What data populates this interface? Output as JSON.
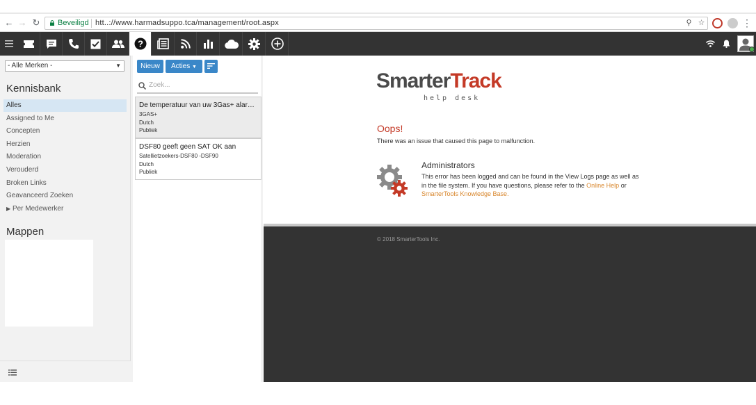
{
  "browser": {
    "secure_label": "Beveiligd",
    "url": "htt..://www.harmadsuppo.tca/management/root.aspx"
  },
  "toolbar": {
    "icons": [
      "ticket-icon",
      "chat-icon",
      "phone-icon",
      "task-check-icon",
      "users-icon",
      "help-icon",
      "news-icon",
      "rss-icon",
      "reports-chart-icon",
      "cloud-icon",
      "settings-gear-icon",
      "add-circle-icon"
    ],
    "active_index": 5
  },
  "left": {
    "brand_select": "- Alle Merken -",
    "kb_title": "Kennisbank",
    "items": [
      {
        "label": "Alles",
        "selected": true
      },
      {
        "label": "Assigned to Me"
      },
      {
        "label": "Concepten"
      },
      {
        "label": "Herzien"
      },
      {
        "label": "Moderation"
      },
      {
        "label": "Verouderd"
      },
      {
        "label": "Broken Links"
      },
      {
        "label": "Geavanceerd Zoeken"
      },
      {
        "label": "Per Medewerker"
      }
    ],
    "folders_title": "Mappen"
  },
  "list": {
    "new_label": "Nieuw",
    "actions_label": "Acties",
    "search_placeholder": "Zoek...",
    "articles": [
      {
        "title": "De temperatuur van uw 3Gas+ alarm of ...",
        "tag": "3GAS+",
        "language": "Dutch",
        "visibility": "Publiek"
      },
      {
        "title": "DSF80 geeft geen SAT OK aan",
        "tag": "Satellietzoekers-DSF80 -DSF90",
        "language": "Dutch",
        "visibility": "Publiek"
      }
    ]
  },
  "content": {
    "logo_main_a": "Smarter",
    "logo_main_b": "Track",
    "logo_sub": "help desk",
    "oops": "Oops!",
    "oops_sub": "There was an issue that caused this page to malfunction.",
    "admin_title": "Administrators",
    "admin_text_1": "This error has been logged and can be found in the View Logs page as well as in the file system. If you have questions, please refer to the",
    "online_help": "Online Help",
    "or": "or",
    "kb_link": "SmarterTools Knowledge Base.",
    "copyright": "© 2018 SmarterTools Inc."
  },
  "colors": {
    "accent": "#3a87c8",
    "brand_red": "#c43a27",
    "dark": "#333333",
    "link": "#d8862c"
  }
}
